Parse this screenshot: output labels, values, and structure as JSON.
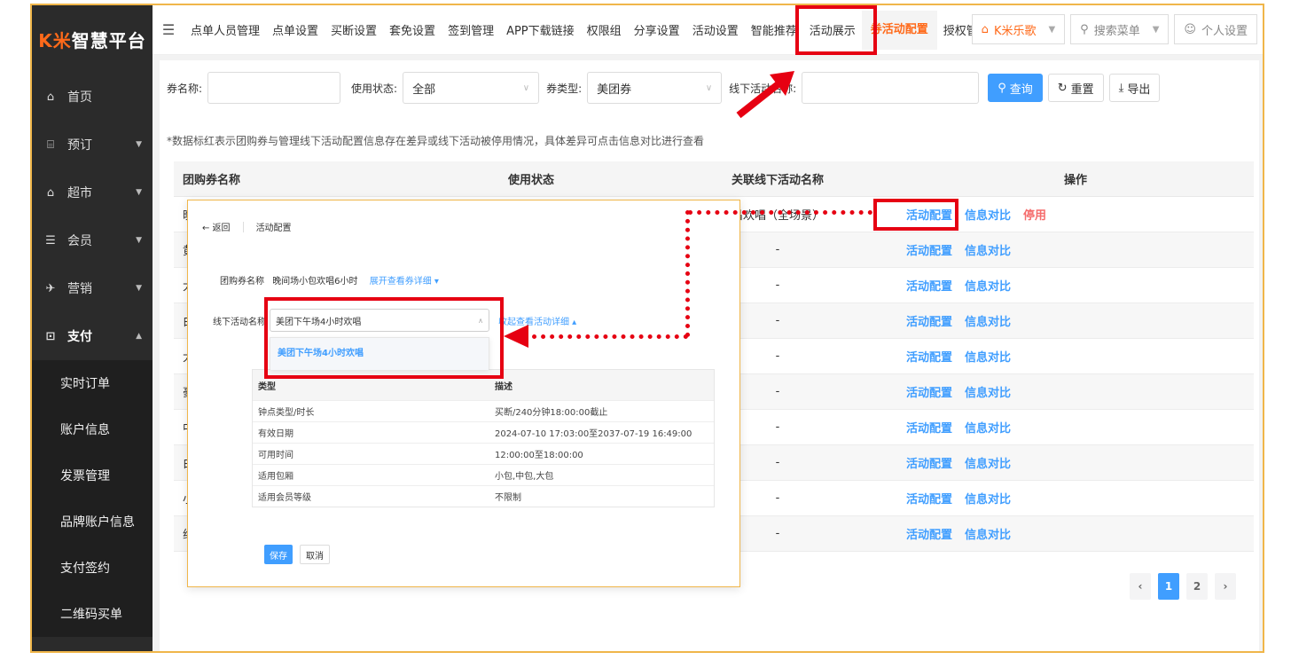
{
  "logo": {
    "k": "K米",
    "text": "智慧平台"
  },
  "sidebar": {
    "items": [
      {
        "label": "首页",
        "icon": "home-icon",
        "glyph": "⌂",
        "arrow": ""
      },
      {
        "label": "预订",
        "icon": "reserve-icon",
        "glyph": "⌸",
        "arrow": "▼"
      },
      {
        "label": "超市",
        "icon": "cart-icon",
        "glyph": "⌂",
        "arrow": "▼"
      },
      {
        "label": "会员",
        "icon": "member-icon",
        "glyph": "☰",
        "arrow": "▼"
      },
      {
        "label": "营销",
        "icon": "marketing-icon",
        "glyph": "✈",
        "arrow": "▼"
      },
      {
        "label": "支付",
        "icon": "payment-icon",
        "glyph": "⊡",
        "arrow": "▲"
      }
    ],
    "sub_items": [
      "实时订单",
      "账户信息",
      "发票管理",
      "品牌账户信息",
      "支付签约",
      "二维码买单"
    ]
  },
  "topnav": {
    "menu_glyph": "☰",
    "links": [
      "点单人员管理",
      "点单设置",
      "买断设置",
      "套免设置",
      "签到管理",
      "APP下载链接",
      "权限组",
      "分享设置",
      "活动设置",
      "智能推荐",
      "活动展示",
      "券活动配置",
      "授权管理"
    ],
    "active_index": 11,
    "store": "K米乐歌",
    "search_menu": "搜索菜单",
    "personal": "个人设置"
  },
  "filters": {
    "coupon_name_label": "券名称:",
    "coupon_name_value": "",
    "status_label": "使用状态:",
    "status_value": "全部",
    "type_label": "券类型:",
    "type_value": "美团券",
    "activity_label": "线下活动名称:",
    "activity_value": "",
    "query": "查询",
    "reset": "重置",
    "export": "导出"
  },
  "note": "*数据标红表示团购券与管理线下活动配置信息存在差异或线下活动被停用情况，具体差异可点击信息对比进行查看",
  "table": {
    "headers": [
      "团购券名称",
      "使用状态",
      "关联线下活动名称",
      "操作"
    ],
    "rows": [
      {
        "name": "晚",
        "status": "",
        "activity": "昌欢唱（全场景）",
        "ops": [
          "活动配置",
          "信息对比",
          "停用"
        ]
      },
      {
        "name": "黄",
        "status": "",
        "activity": "-",
        "ops": [
          "活动配置",
          "信息对比"
        ]
      },
      {
        "name": "大",
        "status": "",
        "activity": "-",
        "ops": [
          "活动配置",
          "信息对比"
        ]
      },
      {
        "name": "白",
        "status": "",
        "activity": "-",
        "ops": [
          "活动配置",
          "信息对比"
        ]
      },
      {
        "name": "大",
        "status": "",
        "activity": "-",
        "ops": [
          "活动配置",
          "信息对比"
        ]
      },
      {
        "name": "豪",
        "status": "",
        "activity": "-",
        "ops": [
          "活动配置",
          "信息对比"
        ]
      },
      {
        "name": "中",
        "status": "",
        "activity": "-",
        "ops": [
          "活动配置",
          "信息对比"
        ]
      },
      {
        "name": "白",
        "status": "",
        "activity": "-",
        "ops": [
          "活动配置",
          "信息对比"
        ]
      },
      {
        "name": "小",
        "status": "",
        "activity": "-",
        "ops": [
          "活动配置",
          "信息对比"
        ]
      },
      {
        "name": "纯",
        "status": "",
        "activity": "-",
        "ops": [
          "活动配置",
          "信息对比"
        ]
      }
    ]
  },
  "pager": {
    "prev": "‹",
    "pages": [
      "1",
      "2"
    ],
    "current": "1",
    "next": "›"
  },
  "modal": {
    "back": "← 返回",
    "title": "活动配置",
    "coupon_label": "团购券名称",
    "coupon_value": "晚间场小包欢唱6小时",
    "coupon_link": "展开查看券详细 ▾",
    "activity_label": "线下活动名称",
    "activity_value": "美团下午场4小时欢唱",
    "activity_link": "收起查看活动详细 ▴",
    "dropdown_option": "美团下午场4小时欢唱",
    "detail_headers": [
      "类型",
      "描述"
    ],
    "detail_rows": [
      [
        "钟点类型/时长",
        "买断/240分钟18:00:00截止"
      ],
      [
        "有效日期",
        "2024-07-10 17:03:00至2037-07-19 16:49:00"
      ],
      [
        "可用时间",
        "12:00:00至18:00:00"
      ],
      [
        "适用包厢",
        "小包,中包,大包"
      ],
      [
        "适用会员等级",
        "不限制"
      ]
    ],
    "save": "保存",
    "cancel": "取消"
  },
  "colors": {
    "accent": "#ff6a1a",
    "link": "#409eff",
    "annotation": "#e60012",
    "danger": "#f56c6c"
  }
}
